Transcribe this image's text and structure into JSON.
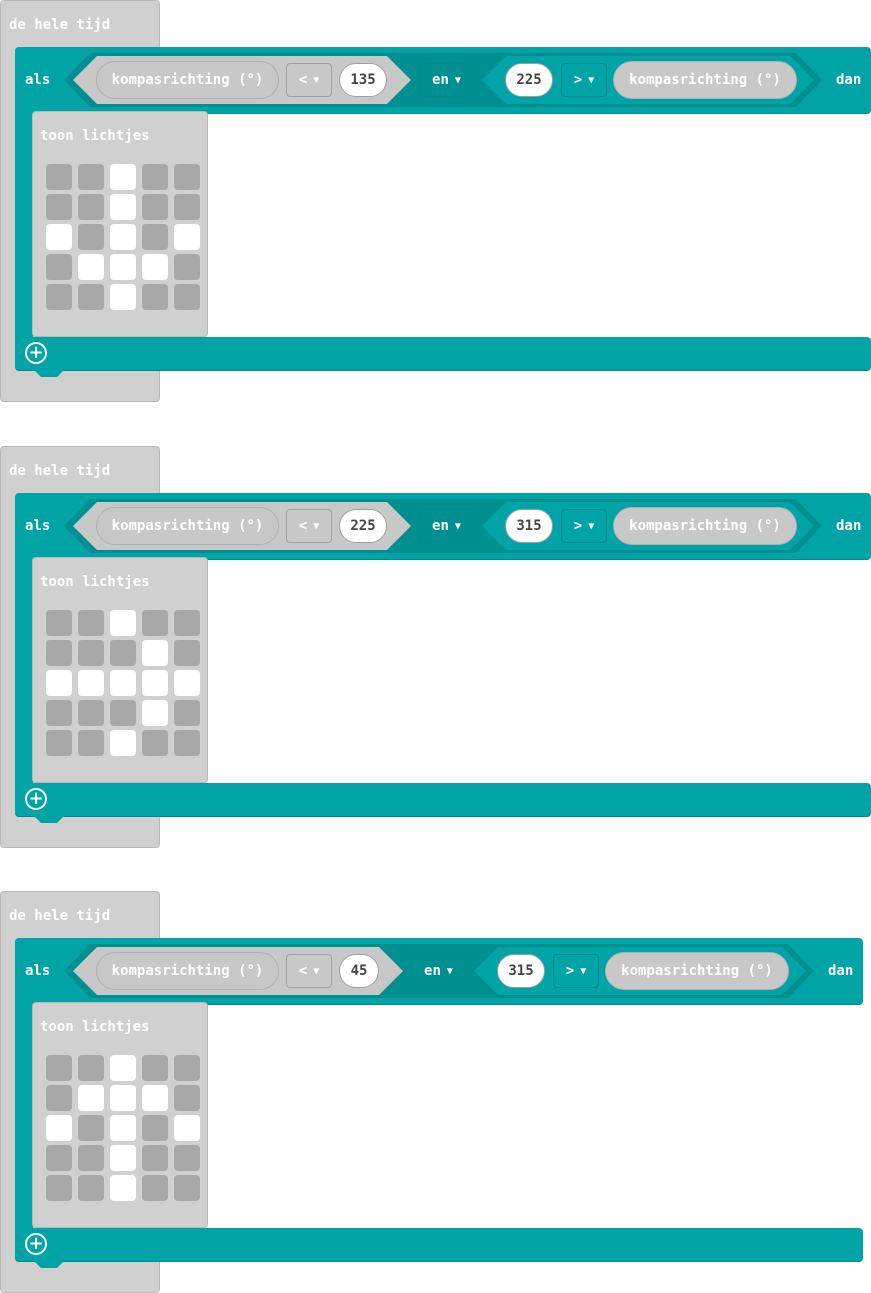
{
  "blocks": [
    {
      "forever_label": "de hele tijd",
      "if_label": "als",
      "then_label": "dan",
      "left_cond": {
        "sensor": "kompasrichting (°)",
        "op": "<",
        "value": "135"
      },
      "logic": "en",
      "right_cond": {
        "value": "225",
        "op": ">",
        "sensor": "kompasrichting (°)"
      },
      "show_label": "toon lichtjes",
      "leds": [
        [
          0,
          0,
          1,
          0,
          0
        ],
        [
          0,
          0,
          1,
          0,
          0
        ],
        [
          1,
          0,
          1,
          0,
          1
        ],
        [
          0,
          1,
          1,
          1,
          0
        ],
        [
          0,
          0,
          1,
          0,
          0
        ]
      ]
    },
    {
      "forever_label": "de hele tijd",
      "if_label": "als",
      "then_label": "dan",
      "left_cond": {
        "sensor": "kompasrichting (°)",
        "op": "<",
        "value": "225"
      },
      "logic": "en",
      "right_cond": {
        "value": "315",
        "op": ">",
        "sensor": "kompasrichting (°)"
      },
      "show_label": "toon lichtjes",
      "leds": [
        [
          0,
          0,
          1,
          0,
          0
        ],
        [
          0,
          0,
          0,
          1,
          0
        ],
        [
          1,
          1,
          1,
          1,
          1
        ],
        [
          0,
          0,
          0,
          1,
          0
        ],
        [
          0,
          0,
          1,
          0,
          0
        ]
      ]
    },
    {
      "forever_label": "de hele tijd",
      "if_label": "als",
      "then_label": "dan",
      "left_cond": {
        "sensor": "kompasrichting (°)",
        "op": "<",
        "value": "45"
      },
      "logic": "en",
      "right_cond": {
        "value": "315",
        "op": ">",
        "sensor": "kompasrichting (°)"
      },
      "show_label": "toon lichtjes",
      "leds": [
        [
          0,
          0,
          1,
          0,
          0
        ],
        [
          0,
          1,
          1,
          1,
          0
        ],
        [
          1,
          0,
          1,
          0,
          1
        ],
        [
          0,
          0,
          1,
          0,
          0
        ],
        [
          0,
          0,
          1,
          0,
          0
        ]
      ]
    }
  ],
  "colors": {
    "logic_teal": "#00a4a6",
    "basic_gray": "#d0d0d0",
    "led_off": "#a8a8a8",
    "led_on": "#ffffff"
  }
}
